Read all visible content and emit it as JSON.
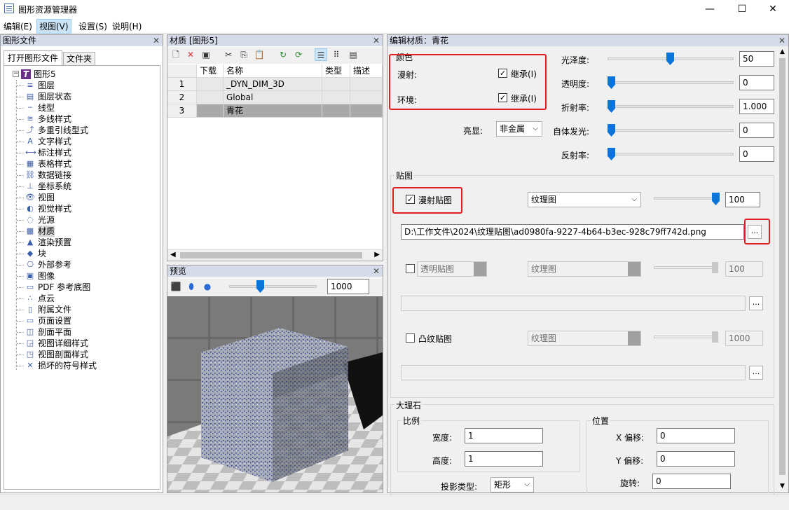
{
  "window": {
    "title": "图形资源管理器",
    "minimize": "—",
    "maximize": "☐",
    "close": "✕"
  },
  "menu": [
    "编辑(E)",
    "视图(V)",
    "设置(S)",
    "说明(H)"
  ],
  "left_panel": {
    "header": "图形文件",
    "tabs": [
      "打开图形文件",
      "文件夹"
    ],
    "root": "图形5",
    "items": [
      "图层",
      "图层状态",
      "线型",
      "多线样式",
      "多重引线型式",
      "文字样式",
      "标注样式",
      "表格样式",
      "数据链接",
      "坐标系统",
      "视图",
      "视觉样式",
      "光源",
      "材质",
      "渲染预置",
      "块",
      "外部参考",
      "图像",
      "PDF 参考底图",
      "点云",
      "附属文件",
      "页面设置",
      "剖面平面",
      "视图详细样式",
      "视图剖面样式",
      "损坏的符号样式"
    ]
  },
  "material_panel": {
    "header": "材质 [图形5]",
    "columns": [
      "下载",
      "名称",
      "类型",
      "描述"
    ],
    "rows": [
      {
        "num": "1",
        "name": "_DYN_DIM_3D"
      },
      {
        "num": "2",
        "name": "Global"
      },
      {
        "num": "3",
        "name": "青花"
      }
    ]
  },
  "preview_panel": {
    "header": "预览",
    "value": "1000"
  },
  "editor": {
    "header": "编辑材质：青花",
    "color_group": "颜色",
    "diffuse_label": "漫射:",
    "ambient_label": "环境:",
    "inherit_label": "继承(I)",
    "highlight_label": "亮显:",
    "highlight_value": "非金属",
    "props": [
      {
        "label": "光泽度:",
        "value": "50",
        "level": 0.5
      },
      {
        "label": "透明度:",
        "value": "0",
        "level": 0
      },
      {
        "label": "折射率:",
        "value": "1.000",
        "level": 0
      },
      {
        "label": "自体发光:",
        "value": "0",
        "level": 0
      },
      {
        "label": "反射率:",
        "value": "0",
        "level": 0
      }
    ],
    "map_group": "贴图",
    "diffuse_map": {
      "label": "漫射贴图",
      "type": "纹理图",
      "value": "100",
      "level": 1.0,
      "path": "D:\\工作文件\\2024\\纹理贴图\\ad0980fa-9227-4b64-b3ec-928c79ff742d.png"
    },
    "opacity_map": {
      "label": "透明贴图",
      "type": "纹理图",
      "value": "100"
    },
    "bump_map": {
      "label": "凸纹贴图",
      "type": "纹理图",
      "value": "1000"
    },
    "browse": "...",
    "marble_group": "大理石",
    "scale_group": "比例",
    "width_label": "宽度:",
    "width_value": "1",
    "height_label": "高度:",
    "height_value": "1",
    "position_group": "位置",
    "xoff_label": "X 偏移:",
    "xoff_value": "0",
    "yoff_label": "Y 偏移:",
    "yoff_value": "0",
    "rot_label": "旋转:",
    "rot_value": "0",
    "proj_label": "投影类型:",
    "proj_value": "矩形"
  },
  "colors": {
    "accent": "#0a74da",
    "highlight_box": "#e02020",
    "panel_header": "#d6dbe9"
  }
}
